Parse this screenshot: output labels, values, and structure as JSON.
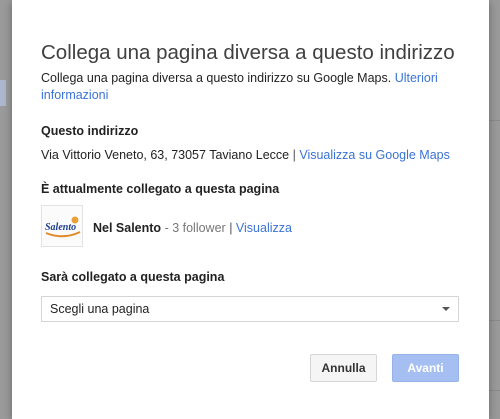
{
  "dialog": {
    "title": "Collega una pagina diversa a questo indirizzo",
    "description": "Collega una pagina diversa a questo indirizzo su Google Maps.",
    "more_info_link": "Ulteriori informazioni"
  },
  "address_section": {
    "label": "Questo indirizzo",
    "address": "Via Vittorio Veneto, 63, 73057 Taviano Lecce",
    "separator": "|",
    "maps_link": "Visualizza su Google Maps"
  },
  "current_page_section": {
    "label": "È attualmente collegato a questa pagina",
    "page_name": "Nel Salento",
    "followers": "- 3 follower",
    "separator": "|",
    "view_link": "Visualizza",
    "logo_text": "Salento"
  },
  "new_page_section": {
    "label": "Sarà collegato a questa pagina",
    "select_value": "Scegli una pagina"
  },
  "buttons": {
    "cancel_label": "Annulla",
    "next_label": "Avanti"
  },
  "colors": {
    "link": "#3b73d6",
    "primary_button_disabled": "#a6bff2"
  }
}
